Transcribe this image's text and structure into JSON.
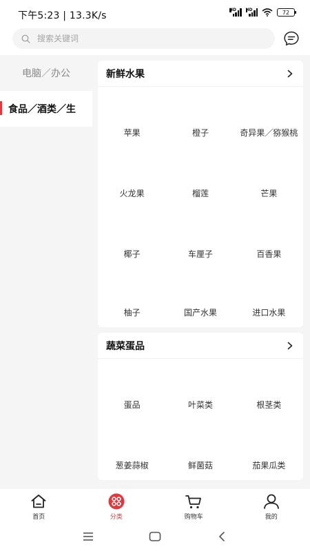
{
  "status": {
    "time": "下午5:23 | 13.3K/s",
    "battery": "72"
  },
  "search": {
    "placeholder": "搜索关键词"
  },
  "sidebar": {
    "items": [
      {
        "label": "电脑／办公",
        "active": false
      },
      {
        "label": "食品／酒类／生",
        "active": true
      }
    ]
  },
  "sections": [
    {
      "title": "新鲜水果",
      "items": [
        "苹果",
        "橙子",
        "奇异果／猕猴桃",
        "火龙果",
        "榴莲",
        "芒果",
        "椰子",
        "车厘子",
        "百香果",
        "柚子",
        "国产水果",
        "进口水果"
      ]
    },
    {
      "title": "蔬菜蛋品",
      "items": [
        "蛋品",
        "叶菜类",
        "根茎类",
        "葱姜蒜椒",
        "鲜菌菇",
        "茄果瓜类"
      ]
    }
  ],
  "tabbar": {
    "tabs": [
      {
        "label": "首页",
        "icon": "home-icon"
      },
      {
        "label": "分类",
        "icon": "category-icon",
        "active": true
      },
      {
        "label": "购物车",
        "icon": "cart-icon"
      },
      {
        "label": "我的",
        "icon": "user-icon"
      }
    ],
    "accent": "#e4393c"
  },
  "colors": {
    "accent": "#e4393c",
    "background": "#f5f5f5"
  }
}
